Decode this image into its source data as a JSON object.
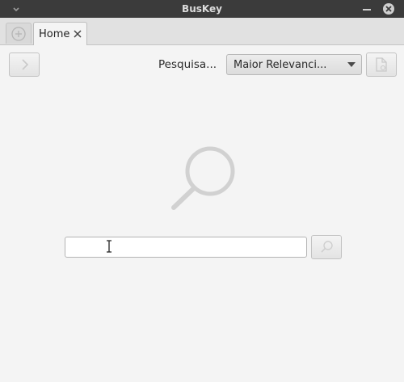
{
  "window": {
    "title": "BusKey",
    "menu_icon": "chevron-down-icon",
    "minimize_icon": "minimize-icon",
    "close_icon": "close-circle-icon"
  },
  "tabs": {
    "new_tab_icon": "plus-circle-icon",
    "items": [
      {
        "label": "Home",
        "close_icon": "close-icon",
        "active": true
      }
    ]
  },
  "toolbar": {
    "forward_icon": "chevron-right-icon",
    "search_mode_label": "Pesquisa...",
    "sort": {
      "selected": "Maior Relevanci...",
      "arrow_icon": "dropdown-arrow-icon"
    },
    "export_icon": "document-icon"
  },
  "main": {
    "placeholder_icon": "magnifier-icon",
    "search": {
      "value": "",
      "placeholder": "",
      "button_icon": "search-icon"
    }
  },
  "colors": {
    "titlebar": "#3b3b3b",
    "tabbar": "#e1e1e1",
    "background": "#f4f4f4",
    "icon_disabled": "#cfcfcf"
  }
}
